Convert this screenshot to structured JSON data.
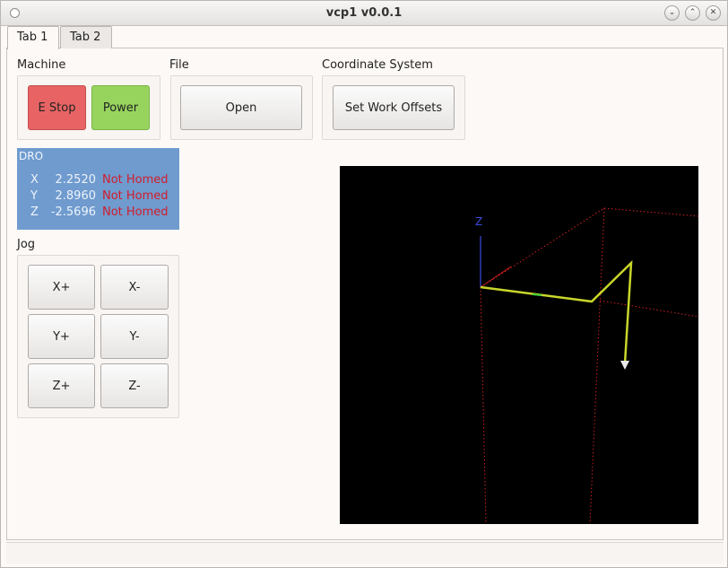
{
  "window": {
    "title": "vcp1 v0.0.1",
    "buttons": {
      "minimize": "⌄",
      "maximize": "⌃",
      "close": "✕"
    }
  },
  "tabs": [
    {
      "label": "Tab 1",
      "active": true
    },
    {
      "label": "Tab 2",
      "active": false
    }
  ],
  "machine": {
    "label": "Machine",
    "estop_label": "E Stop",
    "power_label": "Power"
  },
  "file": {
    "label": "File",
    "open_label": "Open"
  },
  "coordinate_system": {
    "label": "Coordinate System",
    "set_offsets_label": "Set Work Offsets"
  },
  "dro": {
    "title": "DRO",
    "rows": [
      {
        "axis": "X",
        "value": "2.2520",
        "status": "Not Homed"
      },
      {
        "axis": "Y",
        "value": "2.8960",
        "status": "Not Homed"
      },
      {
        "axis": "Z",
        "value": "-2.5696",
        "status": "Not Homed"
      }
    ]
  },
  "jog": {
    "label": "Jog",
    "buttons": [
      "X+",
      "X-",
      "Y+",
      "Y-",
      "Z+",
      "Z-"
    ]
  },
  "viewport": {
    "axis_z_label": "Z"
  },
  "colors": {
    "estop": "#e86464",
    "power": "#97d45e",
    "dro_bg": "#6f9bcf",
    "not_homed": "#d11d2b",
    "toolpath": "#c8d62a",
    "limits": "#d22020",
    "axis_z": "#3a4de0"
  }
}
